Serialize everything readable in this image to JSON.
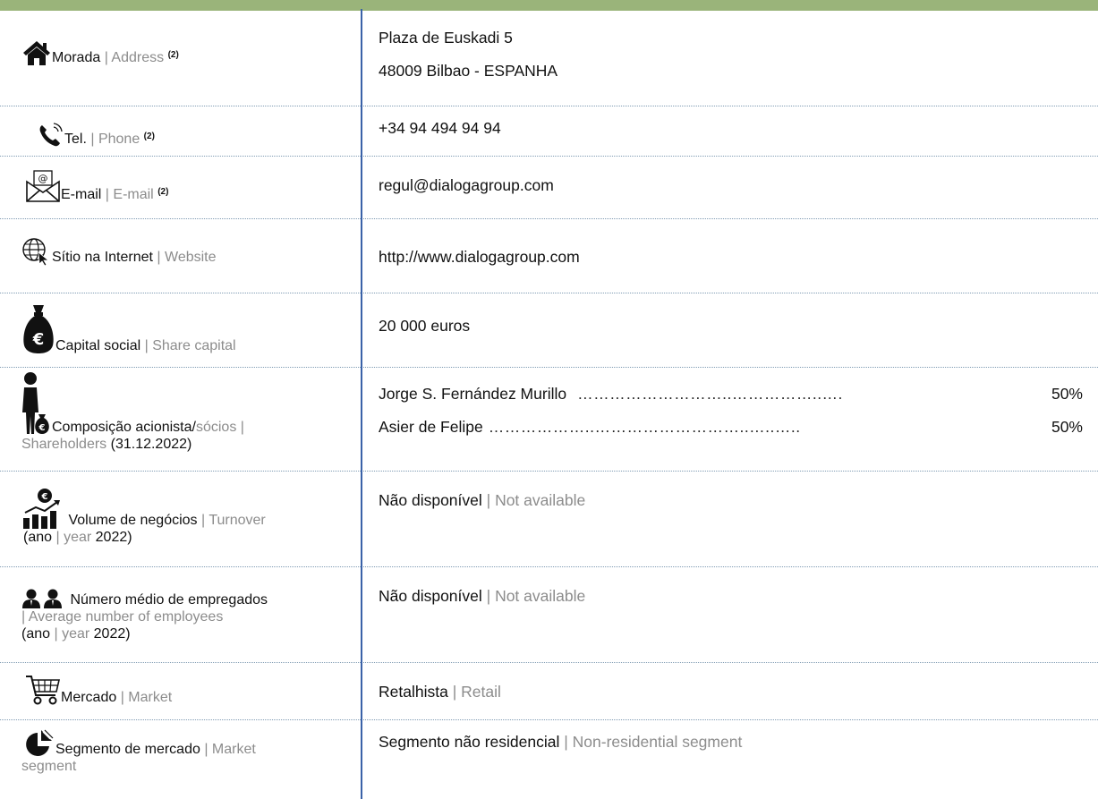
{
  "rows": [
    {
      "pt": "Morada",
      "en": "Address",
      "note": "(2)",
      "icon": "house-icon",
      "values": [
        "Plaza de Euskadi 5",
        "48009 Bilbao - ESPANHA"
      ]
    },
    {
      "pt": "Tel.",
      "en": "Phone",
      "note": "(2)",
      "icon": "phone-icon",
      "values": [
        "+34 94 494 94 94"
      ]
    },
    {
      "pt": "E-mail",
      "en": "E-mail",
      "note": "(2)",
      "icon": "envelope-icon",
      "values": [
        "regul@dialogagroup.com"
      ]
    },
    {
      "pt": "Sítio na Internet",
      "en": "Website",
      "icon": "globe-cursor-icon",
      "values": [
        "http://www.dialogagroup.com"
      ]
    },
    {
      "pt": "Capital social",
      "en": "Share capital",
      "icon": "money-bag-euro-icon",
      "values": [
        "20 000 euros"
      ]
    },
    {
      "pt": "Composição acionista/",
      "pt_gray": "sócios",
      "sep": " |",
      "en": "Shareholders",
      "extra": " (31.12.2022)",
      "icon": "person-money-bag-icon",
      "shareholders": [
        {
          "name": "Jorge S. Fernández Murillo",
          "dots": "………………………..……………..….",
          "pct": "50%"
        },
        {
          "name": "Asier de Felipe",
          "dots": "………………..………………………..…..…..",
          "pct": "50%"
        }
      ]
    },
    {
      "pt": "Volume de negócios",
      "en": "Turnover",
      "paren_pt": "(ano",
      "paren_en": "year",
      "paren_end": "2022)",
      "icon": "chart-growth-euro-icon",
      "value_pt": "Não disponível",
      "value_en": "Not available"
    },
    {
      "pt": "Número médio de empregados",
      "en": "Average number of employees",
      "paren_pt": "(ano",
      "paren_en": "year",
      "paren_end": "2022)",
      "icon": "two-people-icon",
      "value_pt": "Não disponível",
      "value_en": "Not available"
    },
    {
      "pt": "Mercado",
      "en": "Market",
      "icon": "shopping-cart-icon",
      "value_pt": "Retalhista",
      "value_en": "Retail"
    },
    {
      "pt": "Segmento de mercado",
      "en": "Market segment",
      "icon": "pie-segment-icon",
      "value_pt": "Segmento não residencial",
      "value_en": "Non-residential segment"
    }
  ],
  "colors": {
    "header_bar": "#9ab47a",
    "divider": "#3a62a8",
    "secondary_text": "#8c8c8c"
  }
}
